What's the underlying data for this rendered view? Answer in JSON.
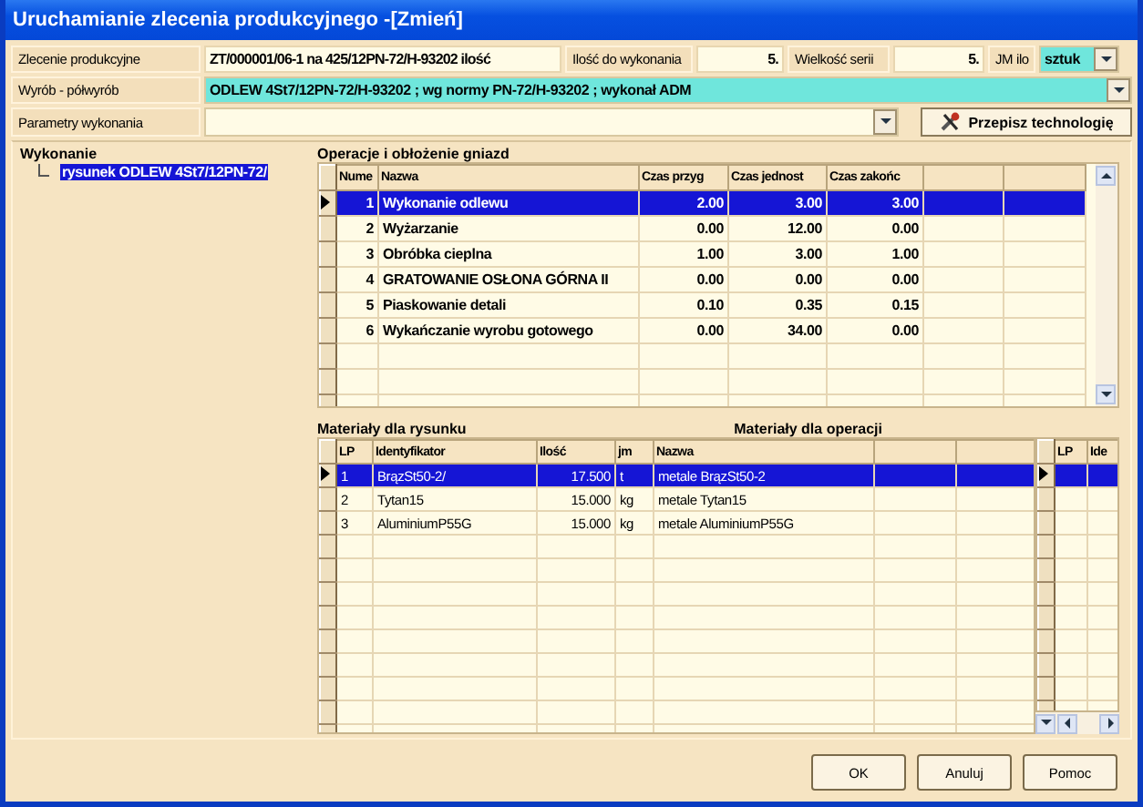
{
  "window": {
    "title": "Uruchamianie zlecenia produkcyjnego -[Zmień]"
  },
  "form": {
    "order_label": "Zlecenie produkcyjne",
    "order_value": "ZT/000001/06-1 na 425/12PN-72/H-93202 ilość",
    "qty_label": "Ilość do wykonania",
    "qty_value": "5.",
    "batch_label": "Wielkość serii",
    "batch_value": "5.",
    "unit_label": "JM ilo",
    "unit_value": "sztuk",
    "product_label": "Wyrób - półwyrób",
    "product_value": "ODLEW 4St7/12PN-72/H-93202 ; wg normy PN-72/H-93202 ; wykonał ADM",
    "params_label": "Parametry wykonania",
    "rewrite_button": "Przepisz technologię"
  },
  "tree": {
    "title": "Wykonanie",
    "items": [
      {
        "label": "rysunek ODLEW 4St7/12PN-72/",
        "selected": true
      }
    ]
  },
  "operations": {
    "title": "Operacje i obłożenie gniazd",
    "columns": [
      "Nume",
      "Nazwa",
      "Czas przyg",
      "Czas jednost",
      "Czas zakońc"
    ],
    "rows": [
      {
        "cells": [
          "1",
          "Wykonanie odlewu",
          "2.00",
          "3.00",
          "3.00"
        ],
        "selected": true
      },
      {
        "cells": [
          "2",
          "Wyżarzanie",
          "0.00",
          "12.00",
          "0.00"
        ],
        "selected": false
      },
      {
        "cells": [
          "3",
          "Obróbka cieplna",
          "1.00",
          "3.00",
          "1.00"
        ],
        "selected": false
      },
      {
        "cells": [
          "4",
          "GRATOWANIE OSŁONA GÓRNA II",
          "0.00",
          "0.00",
          "0.00"
        ],
        "selected": false
      },
      {
        "cells": [
          "5",
          "Piaskowanie detali",
          "0.10",
          "0.35",
          "0.15"
        ],
        "selected": false
      },
      {
        "cells": [
          "6",
          "Wykańczanie wyrobu gotowego",
          "0.00",
          "34.00",
          "0.00"
        ],
        "selected": false
      }
    ]
  },
  "drawing_materials": {
    "title": "Materiały dla rysunku",
    "columns": [
      "LP",
      "Identyfikator",
      "Ilość",
      "jm",
      "Nazwa"
    ],
    "rows": [
      {
        "cells": [
          "1",
          "BrązSt50-2/",
          "17.500",
          "t",
          "metale BrązSt50-2"
        ],
        "selected": true
      },
      {
        "cells": [
          "2",
          "Tytan15",
          "15.000",
          "kg",
          "metale Tytan15"
        ],
        "selected": false
      },
      {
        "cells": [
          "3",
          "AluminiumP55G",
          "15.000",
          "kg",
          "metale AluminiumP55G"
        ],
        "selected": false
      }
    ]
  },
  "operation_materials": {
    "title": "Materiały dla operacji",
    "columns": [
      "LP",
      "Ide"
    ],
    "rows": [
      {
        "selected": true
      }
    ]
  },
  "buttons": [
    "OK",
    "Anuluj",
    "Pomoc"
  ]
}
